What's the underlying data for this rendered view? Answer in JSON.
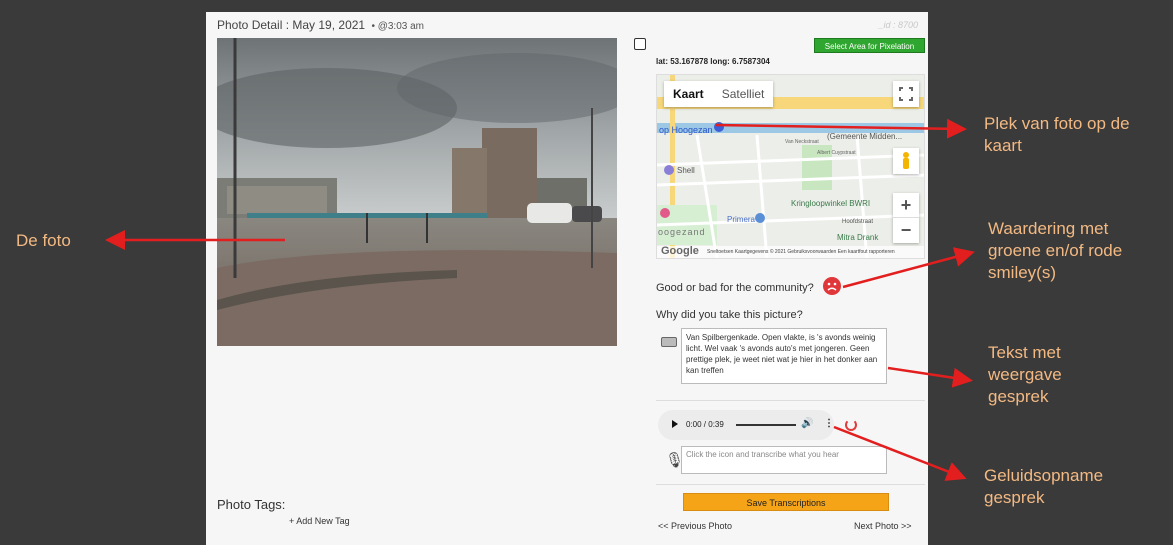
{
  "header": {
    "title": "Photo Detail : May 19, 2021",
    "time": "• @3:03 am",
    "id": "_id : 8700"
  },
  "map": {
    "pixelation_button": "Select Area for Pixelation",
    "coordinates": "lat: 53.167878 long: 6.7587304",
    "tabs": [
      "Kaart",
      "Satelliet"
    ],
    "labels": [
      "op Hoogezan",
      "(Gemeente Midden...",
      "Shell",
      "Kringloopwinkel BWRI",
      "Primera",
      "Mitra Drank",
      "Hoofdstraat",
      "oogezand",
      "Van Neckstraat",
      "Albert Cuypstraat"
    ],
    "logo": "Google",
    "footer": "Sneltoetsen   Kaartgegevens © 2021   Gebruiksvoorwaarden   Een kaartfout rapporteren",
    "zoom_in": "+",
    "zoom_out": "−"
  },
  "rating": {
    "question": "Good or bad for the community?"
  },
  "why": {
    "question": "Why did you take this picture?",
    "answer": "Van Spilbergenkade. Open vlakte, is 's avonds weinig licht. Wel vaak 's avonds auto's met jongeren. Geen prettige plek, je weet niet wat je hier in het donker aan kan treffen"
  },
  "audio": {
    "time": "0:00 / 0:39"
  },
  "transcription": {
    "placeholder": "Click the icon and transcribe what you hear",
    "save_label": "Save Transcriptions"
  },
  "tags": {
    "label": "Photo Tags:",
    "add_label": "+ Add New Tag"
  },
  "nav": {
    "prev": "<< Previous Photo",
    "next": "Next Photo >>"
  },
  "callouts": {
    "photo": "De foto",
    "map": "Plek van foto op de kaart",
    "rating": "Waardering met groene en/of rode smiley(s)",
    "text": "Tekst met weergave gesprek",
    "audio": "Geluidsopname gesprek"
  },
  "colors": {
    "background": "#3a3a3a",
    "callout_text": "#f3b983",
    "arrow": "#e31e1e",
    "save_button": "#f5a418",
    "pixelation_button": "#2fa62f",
    "sad_smiley": "#e0373a"
  }
}
